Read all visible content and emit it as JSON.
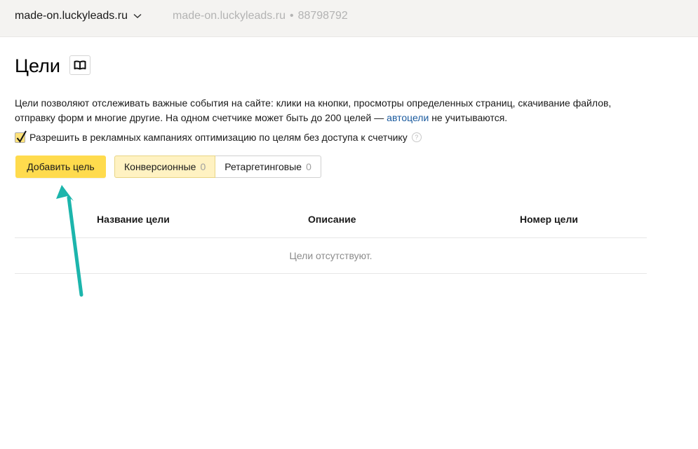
{
  "header": {
    "site_name": "made-on.luckyleads.ru",
    "counter_site": "made-on.luckyleads.ru",
    "separator": "•",
    "counter_id": "88798792"
  },
  "page": {
    "title": "Цели",
    "description_before_link": "Цели позволяют отслеживать важные события на сайте: клики на кнопки, просмотры определенных страниц, скачивание файлов, отправку форм и многие другие. На одном счетчике может быть до 200 целей — ",
    "description_link": "автоцели",
    "description_after_link": " не учитываются.",
    "checkbox_label": "Разрешить в рекламных кампаниях оптимизацию по целям без доступа к счетчику",
    "checkbox_checked": true,
    "help_glyph": "?"
  },
  "actions": {
    "add_goal_label": "Добавить цель"
  },
  "tabs": [
    {
      "label": "Конверсионные",
      "count": "0"
    },
    {
      "label": "Ретаргетинговые",
      "count": "0"
    }
  ],
  "table": {
    "columns": [
      "Название цели",
      "Описание",
      "Номер цели"
    ],
    "empty_text": "Цели отсутствуют."
  },
  "colors": {
    "accent_yellow": "#ffdb4d",
    "active_tab_bg": "#fff2c2",
    "link_blue": "#1a5a9e",
    "annotation_arrow": "#1cb5ac"
  },
  "icons": {
    "site_dropdown": "chevron-down-icon",
    "help": "book-icon",
    "checkbox": "checkmark-icon",
    "hint": "question-icon",
    "annotation": "arrow-icon"
  }
}
